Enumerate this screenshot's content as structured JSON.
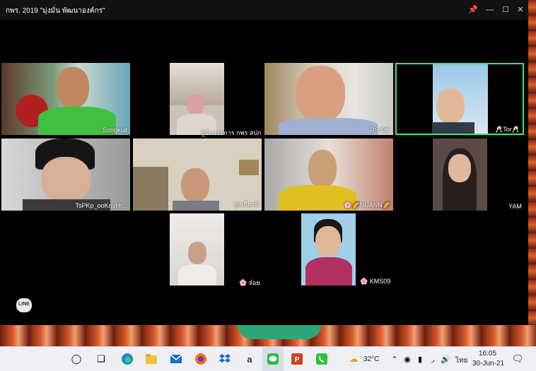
{
  "window": {
    "title": "กพร. 2019 \"มุ่งมั่น พัฒนาองค์กร\""
  },
  "participants": [
    {
      "name": "Songkiat",
      "active": false
    },
    {
      "name": "ผู้อำนวยการ กพร สปก",
      "active": false
    },
    {
      "name": "PS.Off",
      "active": true
    },
    {
      "name": "🥂Tor🥂",
      "active": true
    },
    {
      "name": "TsPKp_ooKm/Hr...",
      "active": false
    },
    {
      "name": "พูลเกียรติ",
      "active": false
    },
    {
      "name": "🌸🌈NUANN🌈",
      "active": false
    },
    {
      "name": "YAM",
      "active": false
    },
    {
      "name": "🌸 จ๋อย",
      "active": false
    },
    {
      "name": "🌸 KMS09",
      "active": false
    }
  ],
  "line_badge": "LINE",
  "taskbar": {
    "weather": "32°C",
    "language": "ไทย",
    "time": "16:05",
    "date": "30-Jun-21"
  },
  "colors": {
    "active_speaker_border": "#3ee86a",
    "window_bg": "#000000",
    "taskbar_bg": "#eef0f4"
  },
  "icons": {
    "start": "circle-icon",
    "task_view": "task-view-icon",
    "edge": "edge-icon",
    "explorer": "folder-icon",
    "mail": "mail-icon",
    "firefox": "firefox-icon",
    "dropbox": "dropbox-icon",
    "amazon": "amazon-icon",
    "line": "line-icon",
    "powerpoint": "powerpoint-icon",
    "phone": "phone-icon"
  }
}
